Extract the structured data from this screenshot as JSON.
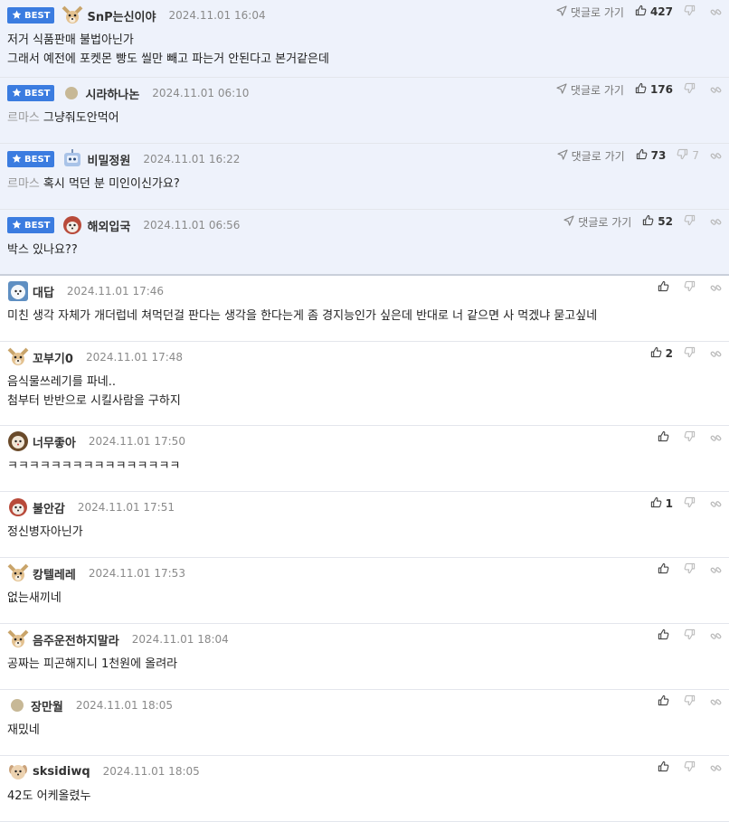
{
  "labels": {
    "best": "BEST",
    "goto": "댓글로 가기"
  },
  "colors": {
    "accent": "#3b7ce0",
    "best_bg": "#eef2fb"
  },
  "comments": [
    {
      "best": true,
      "avatar": "chihuahua",
      "nick": "SnP는신이야",
      "date": "2024.11.01 16:04",
      "likes": "427",
      "dislikes": "",
      "lines": [
        "저거 식품판매 불법아닌가",
        "그래서 예전에 포켓몬 빵도 씰만 빼고 파는거 안된다고 본거같은데"
      ],
      "tag": ""
    },
    {
      "best": true,
      "avatar": "dot",
      "nick": "시라하나논",
      "date": "2024.11.01 06:10",
      "likes": "176",
      "dislikes": "",
      "lines": [
        "그냥줘도안먹어"
      ],
      "tag": "르마스"
    },
    {
      "best": true,
      "avatar": "robot",
      "nick": "비밀정원",
      "date": "2024.11.01 16:22",
      "likes": "73",
      "dislikes": "7",
      "lines": [
        "혹시 먹던 분 미인이신가요?"
      ],
      "tag": "르마스"
    },
    {
      "best": true,
      "avatar": "dog-red",
      "nick": "해외입국",
      "date": "2024.11.01 06:56",
      "likes": "52",
      "dislikes": "",
      "lines": [
        "박스 있나요??"
      ],
      "tag": ""
    },
    {
      "best": false,
      "avatar": "bear",
      "nick": "대답",
      "date": "2024.11.01 17:46",
      "likes": "",
      "dislikes": "",
      "lines": [
        "미친 생각 자체가 개더럽네 쳐먹던걸 판다는 생각을 한다는게 좀 경지능인가 싶은데 반대로 너 같으면 사 먹겠냐 묻고싶네"
      ],
      "tag": ""
    },
    {
      "best": false,
      "avatar": "chihuahua",
      "nick": "꼬부기0",
      "date": "2024.11.01 17:48",
      "likes": "2",
      "dislikes": "",
      "lines": [
        "음식물쓰레기를 파네..",
        "첨부터 반반으로 시킬사람을 구하지"
      ],
      "tag": ""
    },
    {
      "best": false,
      "avatar": "lion",
      "nick": "너무좋아",
      "date": "2024.11.01 17:50",
      "likes": "",
      "dislikes": "",
      "lines": [
        "ㅋㅋㅋㅋㅋㅋㅋㅋㅋㅋㅋㅋㅋㅋㅋㅋ"
      ],
      "tag": ""
    },
    {
      "best": false,
      "avatar": "dog-red",
      "nick": "불안감",
      "date": "2024.11.01 17:51",
      "likes": "1",
      "dislikes": "",
      "lines": [
        "정신병자아닌가"
      ],
      "tag": ""
    },
    {
      "best": false,
      "avatar": "chihuahua",
      "nick": "캉텔레레",
      "date": "2024.11.01 17:53",
      "likes": "",
      "dislikes": "",
      "lines": [
        "없는새끼네"
      ],
      "tag": ""
    },
    {
      "best": false,
      "avatar": "chihuahua",
      "nick": "음주운전하지말라",
      "date": "2024.11.01 18:04",
      "likes": "",
      "dislikes": "",
      "lines": [
        "공짜는 피곤해지니 1천원에 올려라"
      ],
      "tag": ""
    },
    {
      "best": false,
      "avatar": "dot",
      "nick": "장만월",
      "date": "2024.11.01 18:05",
      "likes": "",
      "dislikes": "",
      "lines": [
        "재밌네"
      ],
      "tag": ""
    },
    {
      "best": false,
      "avatar": "puppy",
      "nick": "sksidiwq",
      "date": "2024.11.01 18:05",
      "likes": "",
      "dislikes": "",
      "lines": [
        "42도 어케올렸누"
      ],
      "tag": ""
    }
  ]
}
